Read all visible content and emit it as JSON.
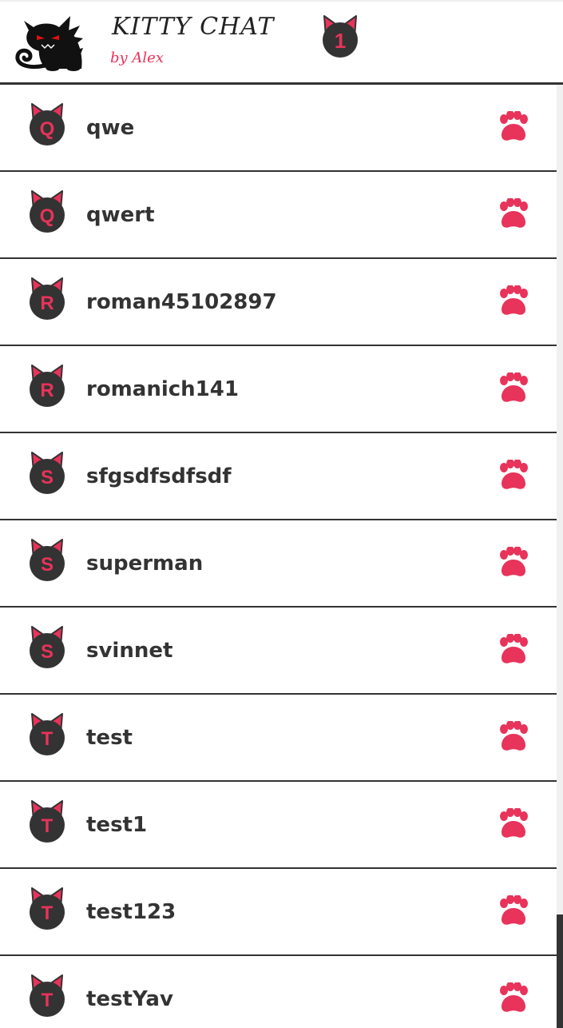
{
  "app": {
    "title": "KITTY CHAT",
    "subtitle": "by Alex",
    "notification_count": "1"
  },
  "colors": {
    "accent": "#e8335a",
    "dark": "#333333",
    "background": "#ffffff"
  },
  "users": [
    {
      "initial": "Q",
      "name": "qwe"
    },
    {
      "initial": "Q",
      "name": "qwert"
    },
    {
      "initial": "R",
      "name": "roman45102897"
    },
    {
      "initial": "R",
      "name": "romanich141"
    },
    {
      "initial": "S",
      "name": "sfgsdfsdfsdf"
    },
    {
      "initial": "S",
      "name": "superman"
    },
    {
      "initial": "S",
      "name": "svinnet"
    },
    {
      "initial": "T",
      "name": "test"
    },
    {
      "initial": "T",
      "name": "test1"
    },
    {
      "initial": "T",
      "name": "test123"
    },
    {
      "initial": "T",
      "name": "testYav"
    }
  ],
  "icons": {
    "logo": "black-cat-logo",
    "badge": "cat-ears-badge",
    "row_action": "paw-icon"
  }
}
